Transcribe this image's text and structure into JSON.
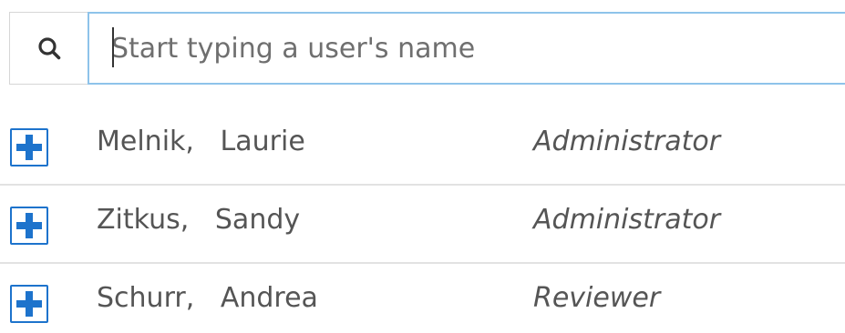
{
  "search": {
    "placeholder": "Start typing a user's name",
    "value": "",
    "icon": "search-icon"
  },
  "users": [
    {
      "last_name": "Melnik",
      "first_name": "Laurie",
      "display": "Melnik,   Laurie",
      "role": "Administrator",
      "action_icon": "plus-icon"
    },
    {
      "last_name": "Zitkus",
      "first_name": "Sandy",
      "display": "Zitkus,   Sandy",
      "role": "Administrator",
      "action_icon": "plus-icon"
    },
    {
      "last_name": "Schurr",
      "first_name": "Andrea",
      "display": "Schurr,   Andrea",
      "role": "Reviewer",
      "action_icon": "plus-icon"
    }
  ],
  "colors": {
    "accent": "#1d73cc",
    "focus_border": "#8ec3ea",
    "text": "#555555",
    "divider": "#e2e2e2"
  }
}
